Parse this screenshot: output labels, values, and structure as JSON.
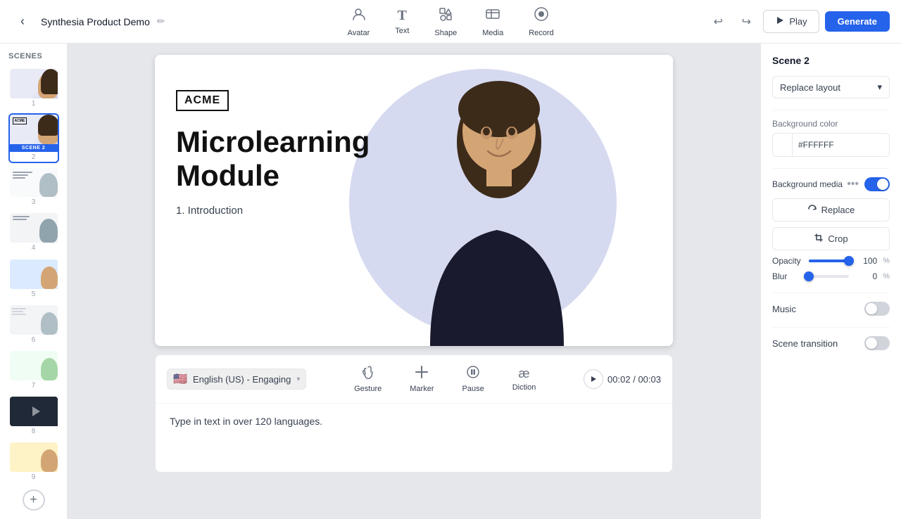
{
  "toolbar": {
    "back_label": "‹",
    "project_title": "Synthesia Product Demo",
    "edit_icon": "✏",
    "tools": [
      {
        "id": "avatar",
        "icon": "👤",
        "label": "Avatar"
      },
      {
        "id": "text",
        "icon": "T",
        "label": "Text"
      },
      {
        "id": "shape",
        "icon": "⬡",
        "label": "Shape"
      },
      {
        "id": "media",
        "icon": "⊞",
        "label": "Media"
      },
      {
        "id": "record",
        "icon": "⏺",
        "label": "Record"
      }
    ],
    "undo_icon": "↩",
    "redo_icon": "↪",
    "play_label": "Play",
    "generate_label": "Generate"
  },
  "scenes": {
    "label": "Scenes",
    "items": [
      {
        "num": "1",
        "active": false
      },
      {
        "num": "2",
        "active": true,
        "badge": "SCENE 2"
      },
      {
        "num": "3",
        "active": false
      },
      {
        "num": "4",
        "active": false
      },
      {
        "num": "5",
        "active": false
      },
      {
        "num": "6",
        "active": false
      },
      {
        "num": "7",
        "active": false
      },
      {
        "num": "8",
        "active": false
      },
      {
        "num": "9",
        "active": false
      }
    ],
    "add_label": "+"
  },
  "canvas": {
    "acme_label": "ACME",
    "title_line1": "Microlearning",
    "title_line2": "Module",
    "subtitle": "1. Introduction"
  },
  "script": {
    "language": "English (US) - Engaging",
    "tools": [
      {
        "id": "gesture",
        "icon": "🤸",
        "label": "Gesture"
      },
      {
        "id": "marker",
        "icon": "✚",
        "label": "Marker"
      },
      {
        "id": "pause",
        "icon": "⏸",
        "label": "Pause"
      },
      {
        "id": "diction",
        "icon": "æ",
        "label": "Diction"
      }
    ],
    "time_current": "00:02",
    "time_total": "00:03",
    "play_icon": "▶",
    "text": "Type in text in over 120 languages."
  },
  "right_panel": {
    "scene_label": "Scene 2",
    "replace_layout": "Replace layout",
    "bg_color_label": "Background color",
    "bg_color_value": "#FFFFFF",
    "bg_media_label": "Background media",
    "replace_btn_label": "Replace",
    "crop_btn_label": "Crop",
    "opacity_label": "Opacity",
    "opacity_value": "100",
    "opacity_percent": "%",
    "blur_label": "Blur",
    "blur_value": "0",
    "blur_percent": "%",
    "music_label": "Music",
    "scene_transition_label": "Scene transition"
  },
  "icons": {
    "replace": "↺",
    "crop": "⊡",
    "chevron_down": "▾",
    "play_triangle": "▶",
    "three_dots": "•••"
  }
}
